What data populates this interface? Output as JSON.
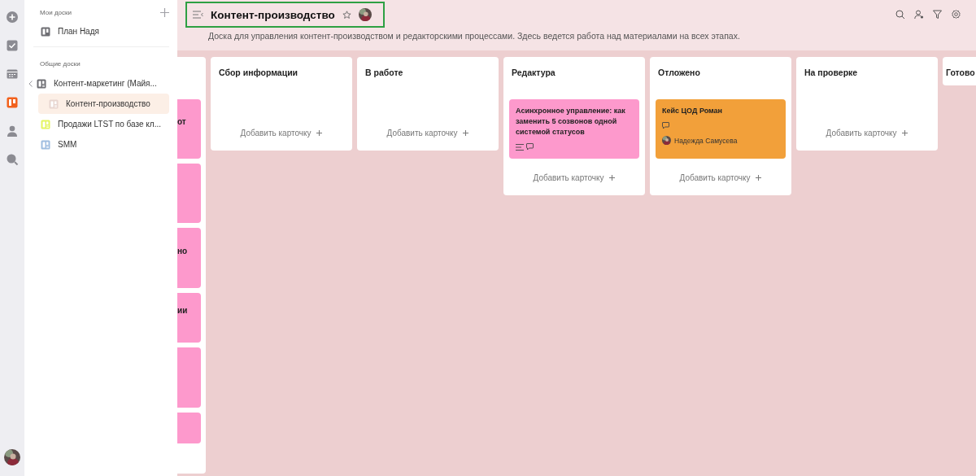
{
  "rail": {
    "items": [
      {
        "kind": "add",
        "selected": false
      },
      {
        "kind": "tasks",
        "selected": false
      },
      {
        "kind": "calendar",
        "selected": false
      },
      {
        "kind": "boards",
        "selected": true
      },
      {
        "kind": "people",
        "selected": false
      },
      {
        "kind": "search",
        "selected": false
      }
    ]
  },
  "sidebar": {
    "my_boards": {
      "title": "Мои доски",
      "items": [
        {
          "label": "План Надя",
          "selected": false,
          "color": "#6f6f74"
        }
      ]
    },
    "shared_boards": {
      "title": "Общие доски",
      "items": [
        {
          "label": "Контент-маркетинг (Майя...",
          "selected": false,
          "color": "#6f6f74",
          "expanded": true,
          "children": [
            {
              "label": "Контент-производство",
              "selected": true,
              "color": "#e8d6d0"
            }
          ]
        },
        {
          "label": "Продажи LTST по базе кл...",
          "selected": false,
          "color": "#e4f560"
        },
        {
          "label": "SMM",
          "selected": false,
          "color": "#9fbde0"
        }
      ]
    }
  },
  "header": {
    "title": "Контент-производство",
    "starred": false,
    "description": "Доска для управления контент-производством и редакторскими процессами. Здесь ведется работа над материалами на всех этапах."
  },
  "partial_column": {
    "cards": [
      {
        "text": "от",
        "color": "#fd99cc"
      },
      {
        "color": "#fd99cc"
      },
      {
        "text": "но",
        "color": "#fd99cc"
      },
      {
        "text": "ии",
        "color": "#fd99cc"
      },
      {
        "color": "#fd99cc"
      },
      {
        "color": "#fd99cc"
      }
    ]
  },
  "columns": [
    {
      "title": "Сбор информации",
      "add_label": "Добавить карточку"
    },
    {
      "title": "В работе",
      "add_label": "Добавить карточку"
    },
    {
      "title": "Редактура",
      "add_label": "Добавить карточку",
      "cards": [
        {
          "title": "Асинхронное управление: как заменить 5 созвонов одной системой статусов",
          "color": "#fd99cc",
          "has_description": true,
          "has_comments": true
        }
      ]
    },
    {
      "title": "Отложено",
      "add_label": "Добавить карточку",
      "cards": [
        {
          "title": "Кейс ЦОД Роман",
          "color": "#f2a03a",
          "has_description": false,
          "has_comments": true,
          "assignee": "Надежда Самусева"
        }
      ]
    },
    {
      "title": "На проверке",
      "add_label": "Добавить карточку"
    },
    {
      "title": "Готово"
    }
  ]
}
